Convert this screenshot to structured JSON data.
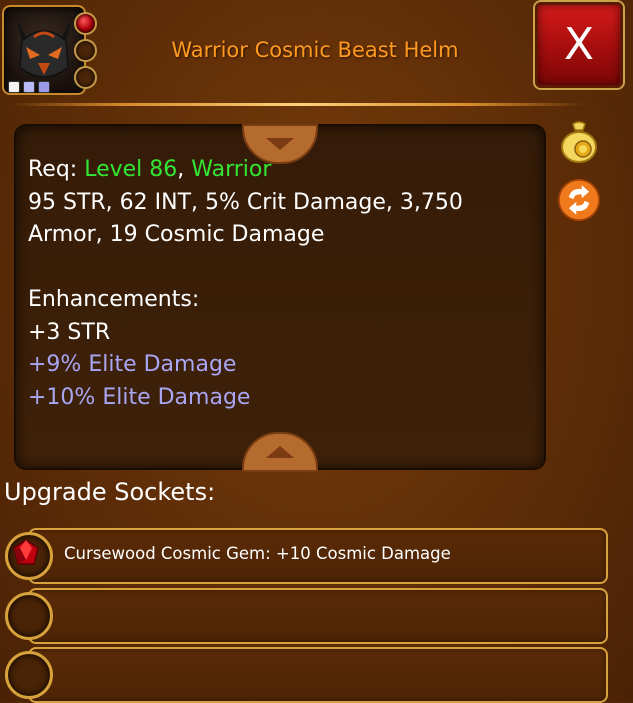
{
  "header": {
    "item_title": "Warrior Cosmic Beast Helm",
    "close_label": "X"
  },
  "stats": {
    "req_prefix": "Req: ",
    "req_level": "Level 86",
    "req_sep": ", ",
    "req_class": "Warrior",
    "line1": "95 STR, 62 INT, 5% Crit Damage, 3,750",
    "line2": "Armor, 19 Cosmic Damage",
    "enhancements_heading": "Enhancements:",
    "enh_1": "+3 STR",
    "enh_2": "+9% Elite Damage",
    "enh_3": "+10% Elite Damage"
  },
  "upgrade_sockets": {
    "heading": "Upgrade Sockets:",
    "slots": [
      {
        "label": "Cursewood Cosmic Gem: +10 Cosmic Damage",
        "filled": true
      },
      {
        "label": "",
        "filled": false
      },
      {
        "label": "",
        "filled": false
      }
    ]
  },
  "colors": {
    "title_orange": "#ff9a1f",
    "requirement_green": "#33e633",
    "enhancement_purple": "#a9a6f3",
    "close_red": "#d61b1b",
    "panel_gold_border": "#d7a23c"
  },
  "icons": {
    "portrait": "beast-helm-icon",
    "side_top": "gold-bag-icon",
    "side_bottom": "swap-arrows-icon",
    "gem": "red-gem-icon"
  }
}
